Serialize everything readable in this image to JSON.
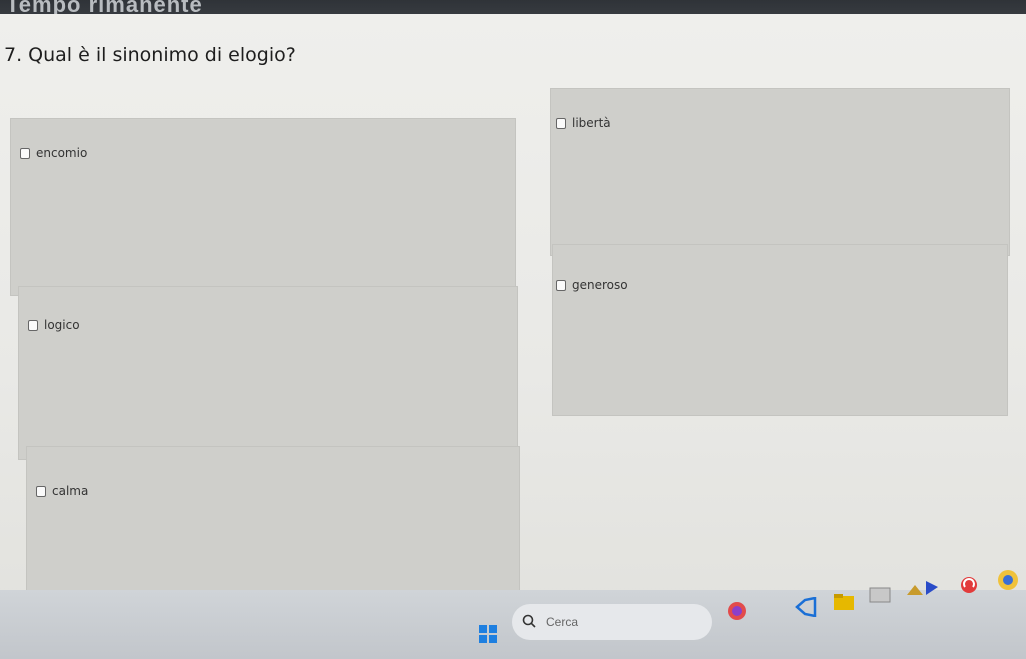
{
  "header": {
    "title": "Tempo rimanente"
  },
  "question": {
    "text": "7. Qual è il sinonimo di elogio?"
  },
  "options": [
    {
      "label": "encomio"
    },
    {
      "label": "libertà"
    },
    {
      "label": "logico"
    },
    {
      "label": "generoso"
    },
    {
      "label": "calma"
    }
  ],
  "taskbar": {
    "search_placeholder": "Cerca",
    "icons": [
      "windows-start-icon",
      "search-icon",
      "firefox-icon",
      "vscode-icon",
      "file-explorer-icon",
      "app-icon",
      "app-icon-2",
      "app-icon-3",
      "app-icon-4",
      "app-icon-5"
    ]
  }
}
